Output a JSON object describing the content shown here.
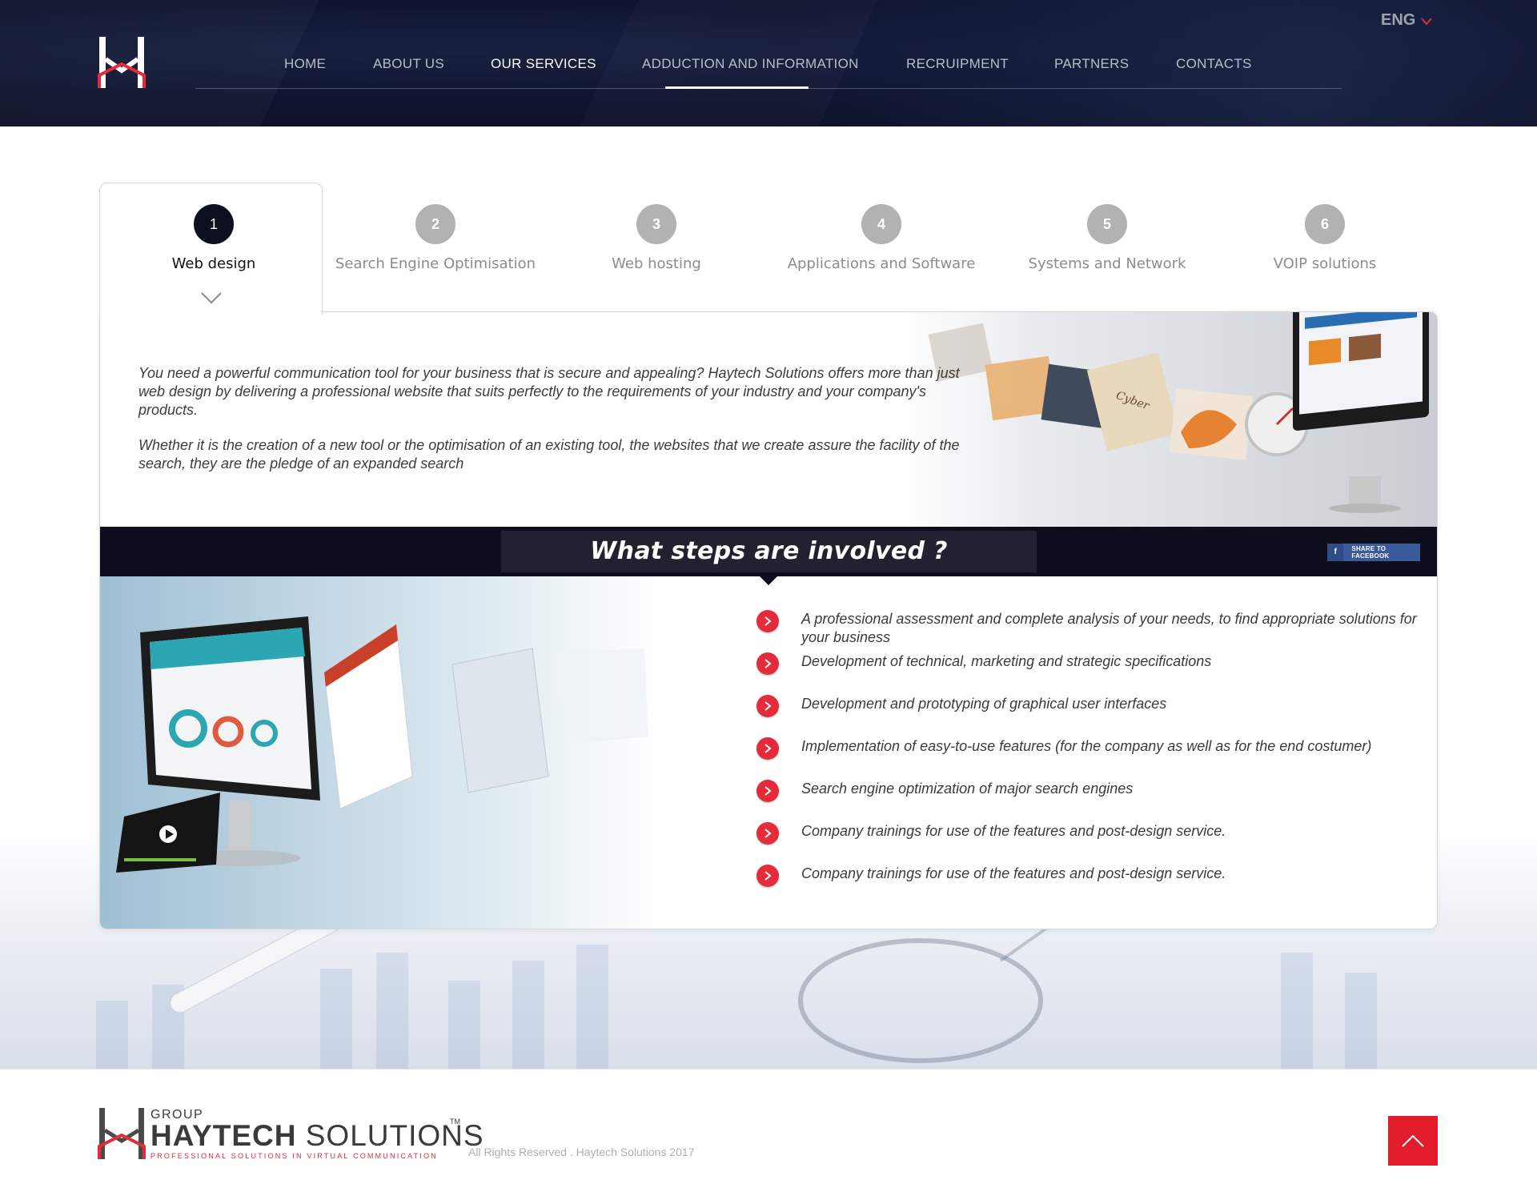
{
  "header": {
    "nav": [
      {
        "label": "HOME"
      },
      {
        "label": "ABOUT US"
      },
      {
        "label": "OUR SERVICES",
        "active": true
      },
      {
        "label": "ADDUCTION AND INFORMATION"
      },
      {
        "label": "RECRUIPMENT"
      },
      {
        "label": "PARTNERS"
      },
      {
        "label": "CONTACTS"
      }
    ],
    "language": "ENG"
  },
  "tabs": [
    {
      "number": "1",
      "label": "Web design",
      "active": true
    },
    {
      "number": "2",
      "label": "Search Engine Optimisation"
    },
    {
      "number": "3",
      "label": "Web hosting"
    },
    {
      "number": "4",
      "label": "Applications and Software"
    },
    {
      "number": "5",
      "label": "Systems and Network"
    },
    {
      "number": "6",
      "label": "VOIP solutions"
    }
  ],
  "intro": {
    "paragraph1": "You need a powerful communication tool for your business that is secure and appealing? Haytech Solutions offers more than just web design by delivering a professional website that suits perfectly to the requirements of your industry and your company's products.",
    "paragraph2": "Whether it is the creation of a new tool or the optimisation of an existing tool, the websites that we create assure the facility of the search, they are the pledge of an expanded search"
  },
  "steps_section": {
    "title": "What steps are involved ?",
    "share_label": "SHARE TO FACEBOOK",
    "steps": [
      "A professional assessment and complete analysis of your needs, to find appropriate solutions for your business",
      "Development of technical, marketing and strategic specifications",
      "Development and prototyping of graphical user interfaces",
      "Implementation of easy-to-use features (for the company as well as for the end costumer)",
      "Search engine optimization of major search engines",
      "Company trainings for use of the features and post-design service.",
      "Company trainings for use of the features and post-design service."
    ]
  },
  "footer": {
    "brand_group": "GROUP",
    "brand_name_bold": "HAYTECH",
    "brand_name_light": "SOLUTIONS",
    "trademark": "TM",
    "tagline": "PROFESSIONAL SOLUTIONS IN VIRTUAL COMMUNICATION",
    "copyright": "All Rights Reserved . Haytech Solutions 2017"
  },
  "colors": {
    "accent_red": "#e52a3a",
    "header_navy": "#0f1530",
    "band_dark": "#0c0e1c",
    "facebook_blue": "#3a5a9b"
  },
  "icons": [
    "haytech-logo-icon",
    "chevron-down-icon",
    "facebook-icon",
    "chevron-right-icon",
    "arrow-up-icon"
  ]
}
